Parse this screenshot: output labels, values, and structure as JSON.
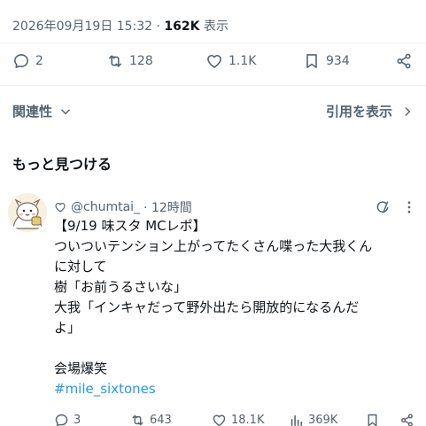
{
  "tweet": {
    "timestamp": "2026年09月19日 15:32",
    "separator": "·",
    "views": "162K",
    "views_label": "表示",
    "replies": "2",
    "retweets": "128",
    "likes": "1.1K",
    "bookmarks": "934"
  },
  "related": {
    "label": "関連性",
    "quotes_label": "引用を表示"
  },
  "more_section": {
    "title": "もっと見つける"
  },
  "post": {
    "handle": "@chumtai_",
    "time": "· 12時間",
    "lines": [
      "【9/19 味スタ MCレポ】",
      "ついついテンション上がってたくさん喋った大我くん",
      "に対して",
      "樹「お前うるさいな」",
      "大我「インキャだって野外出たら開放的になるんだ",
      "よ」",
      "",
      "会場爆笑"
    ],
    "hashtag": "#mile_sixtones",
    "replies": "3",
    "retweets": "643",
    "likes": "18.1K",
    "views": "369K"
  },
  "colors": {
    "text": "#0f1419",
    "secondary": "#536471",
    "link": "#1d9bf0",
    "divider": "#eff3f4"
  }
}
